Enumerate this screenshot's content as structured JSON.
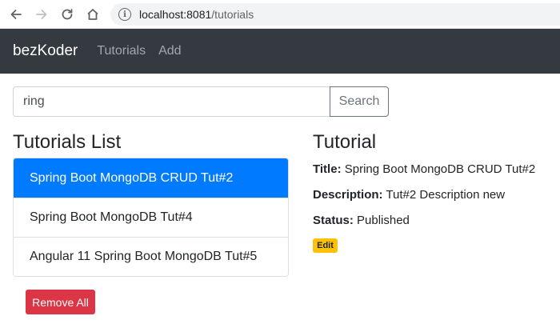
{
  "browser": {
    "url_host": "localhost:8081",
    "url_path": "/tutorials",
    "icons": [
      "back-arrow-icon",
      "forward-arrow-icon",
      "reload-icon",
      "home-icon",
      "info-icon"
    ]
  },
  "navbar": {
    "brand": "bezKoder",
    "links": [
      {
        "label": "Tutorials"
      },
      {
        "label": "Add"
      }
    ],
    "background": "#343a40"
  },
  "search": {
    "value": "ring",
    "button_label": "Search"
  },
  "tutorials_list": {
    "title": "Tutorials List",
    "items": [
      {
        "label": "Spring Boot MongoDB CRUD Tut#2",
        "active": true
      },
      {
        "label": "Spring Boot MongoDB Tut#4",
        "active": false
      },
      {
        "label": "Angular 11 Spring Boot MongoDB Tut#5",
        "active": false
      }
    ],
    "active_color": "#007bff",
    "remove_all_label": "Remove All",
    "remove_all_color": "#dc3545"
  },
  "detail": {
    "heading": "Tutorial",
    "title_label": "Title:",
    "title_value": "Spring Boot MongoDB CRUD Tut#2",
    "description_label": "Description:",
    "description_value": "Tut#2 Description new",
    "status_label": "Status:",
    "status_value": "Published",
    "edit_label": "Edit",
    "edit_color": "#ffc107"
  }
}
